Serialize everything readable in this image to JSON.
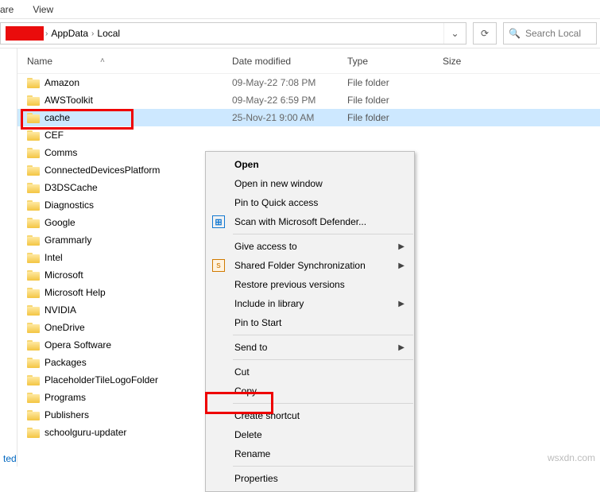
{
  "ribbon": {
    "tab_share": "are",
    "tab_view": "View"
  },
  "address": {
    "crumb1": "AppData",
    "crumb2": "Local",
    "search_placeholder": "Search Local"
  },
  "columns": {
    "name": "Name",
    "date": "Date modified",
    "type": "Type",
    "size": "Size"
  },
  "rows": [
    {
      "name": "Amazon",
      "date": "09-May-22 7:08 PM",
      "type": "File folder",
      "selected": false
    },
    {
      "name": "AWSToolkit",
      "date": "09-May-22 6:59 PM",
      "type": "File folder",
      "selected": false
    },
    {
      "name": "cache",
      "date": "25-Nov-21 9:00 AM",
      "type": "File folder",
      "selected": true
    },
    {
      "name": "CEF",
      "date": "",
      "type": "",
      "selected": false
    },
    {
      "name": "Comms",
      "date": "",
      "type": "",
      "selected": false
    },
    {
      "name": "ConnectedDevicesPlatform",
      "date": "",
      "type": "",
      "selected": false
    },
    {
      "name": "D3DSCache",
      "date": "",
      "type": "",
      "selected": false
    },
    {
      "name": "Diagnostics",
      "date": "",
      "type": "",
      "selected": false
    },
    {
      "name": "Google",
      "date": "",
      "type": "",
      "selected": false
    },
    {
      "name": "Grammarly",
      "date": "",
      "type": "",
      "selected": false
    },
    {
      "name": "Intel",
      "date": "",
      "type": "",
      "selected": false
    },
    {
      "name": "Microsoft",
      "date": "",
      "type": "",
      "selected": false
    },
    {
      "name": "Microsoft Help",
      "date": "",
      "type": "",
      "selected": false
    },
    {
      "name": "NVIDIA",
      "date": "",
      "type": "",
      "selected": false
    },
    {
      "name": "OneDrive",
      "date": "",
      "type": "",
      "selected": false
    },
    {
      "name": "Opera Software",
      "date": "",
      "type": "",
      "selected": false
    },
    {
      "name": "Packages",
      "date": "",
      "type": "",
      "selected": false
    },
    {
      "name": "PlaceholderTileLogoFolder",
      "date": "",
      "type": "",
      "selected": false
    },
    {
      "name": "Programs",
      "date": "",
      "type": "",
      "selected": false
    },
    {
      "name": "Publishers",
      "date": "",
      "type": "",
      "selected": false
    },
    {
      "name": "schoolguru-updater",
      "date": "",
      "type": "",
      "selected": false
    }
  ],
  "ctx": {
    "open": "Open",
    "open_new": "Open in new window",
    "pin_quick": "Pin to Quick access",
    "defender": "Scan with Microsoft Defender...",
    "give_access": "Give access to",
    "shared_sync": "Shared Folder Synchronization",
    "restore_prev": "Restore previous versions",
    "include_lib": "Include in library",
    "pin_start": "Pin to Start",
    "send_to": "Send to",
    "cut": "Cut",
    "copy": "Copy",
    "create_shortcut": "Create shortcut",
    "delete": "Delete",
    "rename": "Rename",
    "properties": "Properties"
  },
  "footer": {
    "selected_link": "ted"
  },
  "watermark": "wsxdn.com"
}
